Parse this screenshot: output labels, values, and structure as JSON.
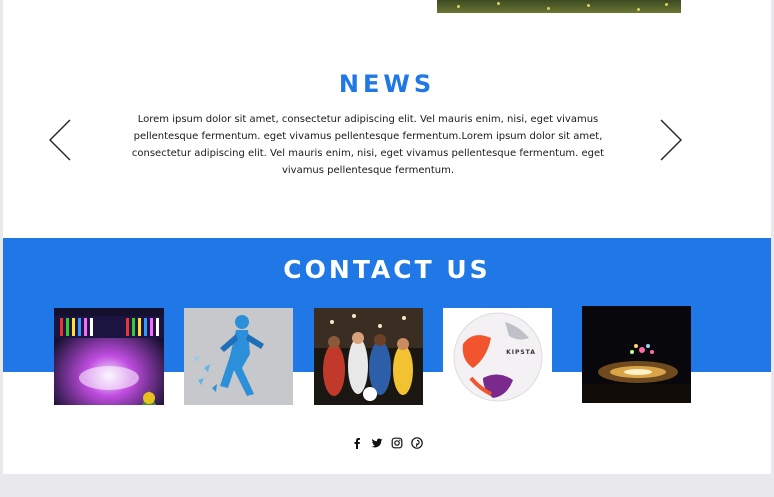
{
  "news": {
    "title": "NEWS",
    "body": "Lorem ipsum dolor sit amet, consectetur adipiscing elit. Vel mauris enim, nisi, eget vivamus pellentesque fermentum.  eget vivamus pellentesque fermentum.Lorem ipsum dolor sit amet, consectetur adipiscing elit. Vel mauris enim, nisi, eget vivamus pellentesque fermentum.  eget vivamus pellentesque fermentum.",
    "prev_icon": "chevron-left-icon",
    "next_icon": "chevron-right-icon"
  },
  "contact": {
    "title": "CONTACT US",
    "photos": [
      {
        "subject": "stadium opening ceremony with flags"
      },
      {
        "subject": "blue runner figure"
      },
      {
        "subject": "collage of athletes"
      },
      {
        "subject": "football with KIPSTA print",
        "ball_text": "KIPSTA"
      },
      {
        "subject": "stadium at night with fireworks"
      }
    ]
  },
  "social": [
    "facebook-icon",
    "twitter-icon",
    "instagram-icon",
    "pinterest-icon"
  ],
  "colors": {
    "accent": "#1f78e6",
    "page_bg": "#e9e9ec",
    "text": "#1a1a1a"
  }
}
